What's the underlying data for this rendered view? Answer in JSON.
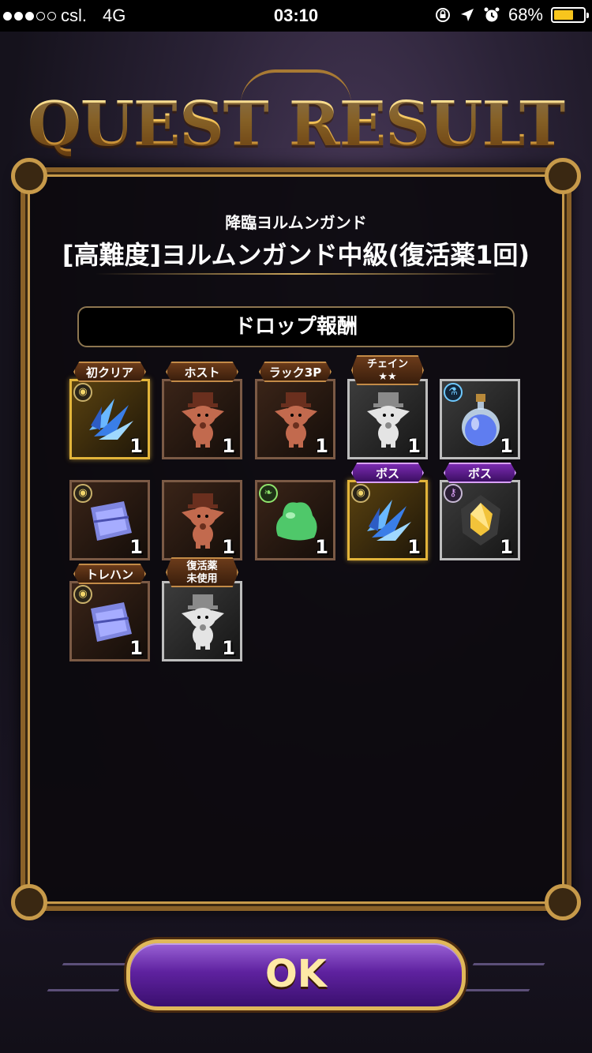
{
  "status_bar": {
    "carrier": "csl.",
    "network": "4G",
    "time": "03:10",
    "battery_percent": "68%",
    "battery_level": 0.68,
    "signal_bars_filled": 3,
    "signal_bars_total": 5,
    "icons": [
      "rotation-lock-icon",
      "location-icon",
      "alarm-icon"
    ]
  },
  "header": {
    "title": "QUEST RESULT"
  },
  "quest": {
    "event_name": "降臨ヨルムンガンド",
    "quest_name": "[高難度]ヨルムンガンド中級(復活薬1回)"
  },
  "drops": {
    "section_title": "ドロップ報酬",
    "items": [
      {
        "tag": "初クリア",
        "count": "1",
        "rarity": "gold",
        "badge_icon": "coin-icon",
        "icon": "blue-crystal-shards-icon"
      },
      {
        "tag": "ホスト",
        "count": "1",
        "rarity": "bronze",
        "badge_icon": "",
        "icon": "bronze-moogle-doll-icon"
      },
      {
        "tag": "ラック3P",
        "count": "1",
        "rarity": "bronze",
        "badge_icon": "",
        "icon": "bronze-moogle-doll-icon"
      },
      {
        "tag": "チェイン\n★★",
        "count": "1",
        "rarity": "silver",
        "badge_icon": "",
        "icon": "silver-moogle-doll-icon"
      },
      {
        "tag": "",
        "count": "1",
        "rarity": "silver",
        "badge_icon": "flask-icon",
        "icon": "blue-potion-icon"
      },
      {
        "tag": "",
        "count": "1",
        "rarity": "bronze",
        "badge_icon": "coin-icon",
        "icon": "blue-crystal-chunk-icon"
      },
      {
        "tag": "",
        "count": "1",
        "rarity": "bronze",
        "badge_icon": "",
        "icon": "bronze-moogle-doll-icon"
      },
      {
        "tag": "",
        "count": "1",
        "rarity": "bronze",
        "badge_icon": "leaf-icon",
        "icon": "green-slime-icon"
      },
      {
        "tag": "ボス",
        "count": "1",
        "rarity": "gold",
        "badge_icon": "coin-icon",
        "icon": "blue-crystal-shards-icon"
      },
      {
        "tag": "ボス",
        "count": "1",
        "rarity": "silver",
        "badge_icon": "key-icon",
        "icon": "gold-gem-icon"
      },
      {
        "tag": "トレハン",
        "count": "1",
        "rarity": "bronze",
        "badge_icon": "coin-icon",
        "icon": "blue-crystal-chunk-icon"
      },
      {
        "tag": "復活薬\n未使用",
        "count": "1",
        "rarity": "silver",
        "badge_icon": "",
        "icon": "silver-moogle-doll-icon"
      }
    ]
  },
  "actions": {
    "ok_label": "OK"
  },
  "colors": {
    "gold_frame": "#c79a4a",
    "purple_button": "#5f22a0",
    "battery_fill": "#f7c51d"
  }
}
